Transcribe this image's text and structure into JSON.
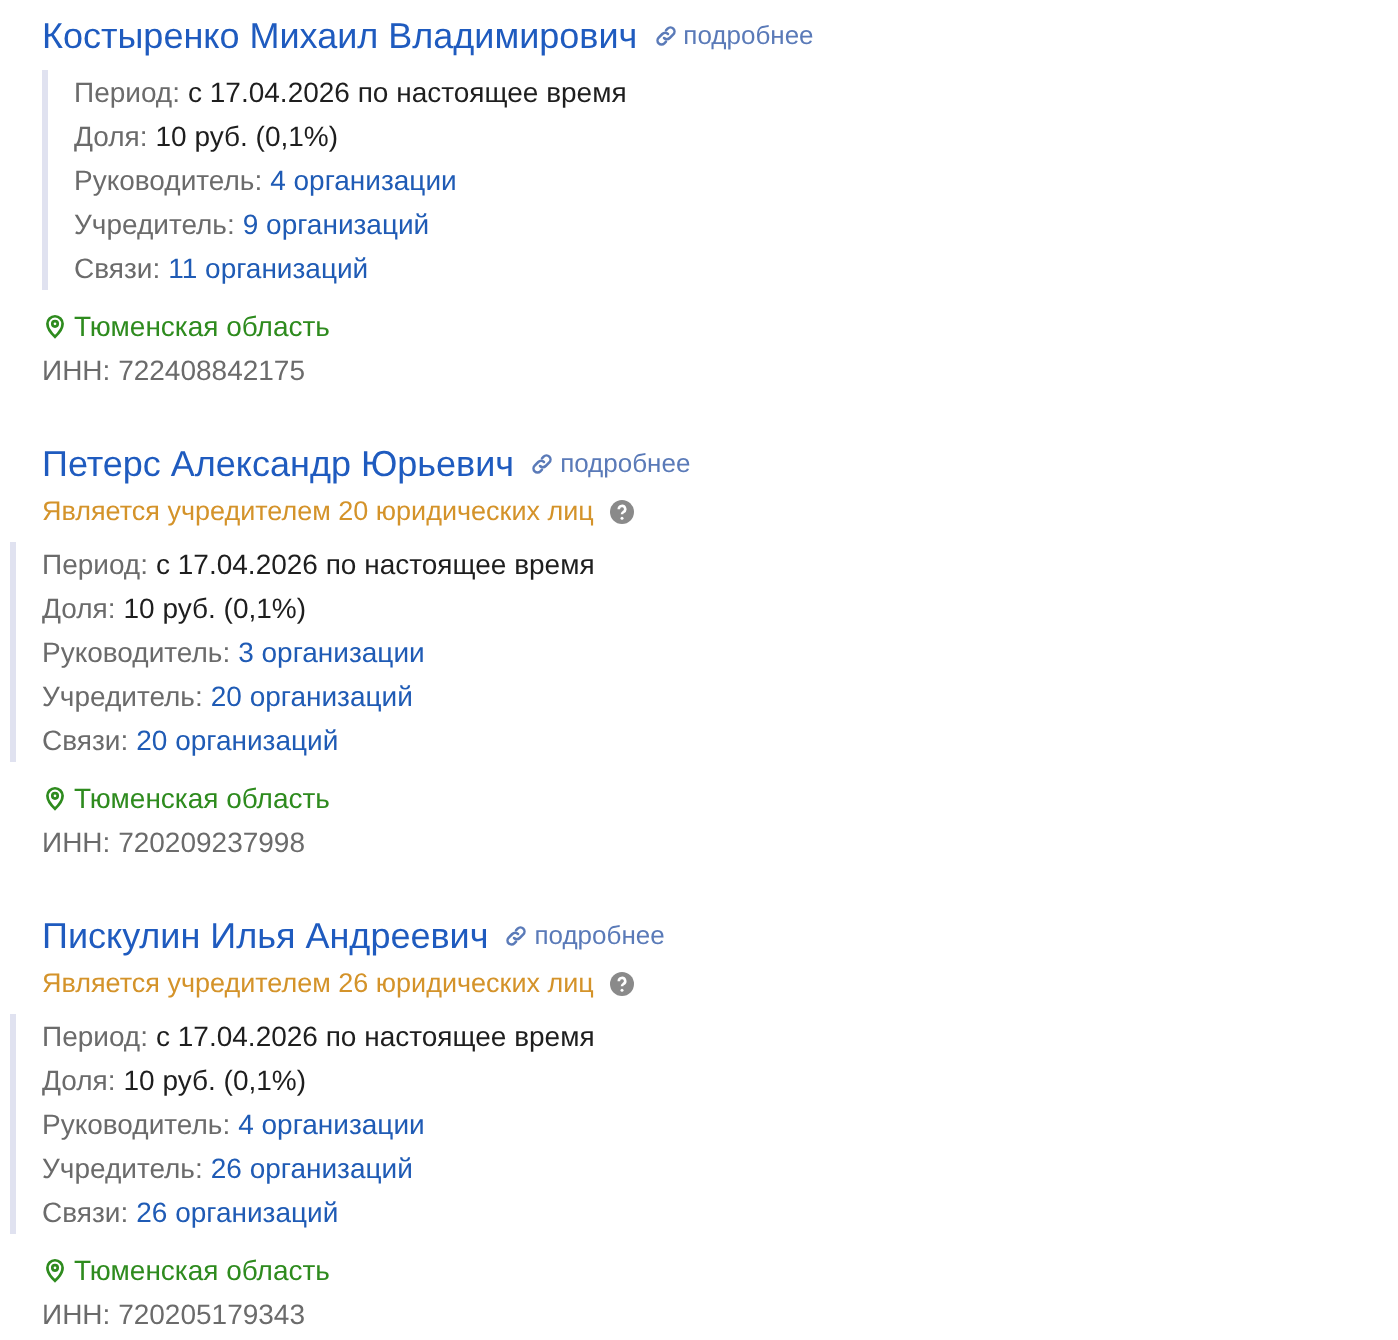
{
  "persons": [
    {
      "name": "Костыренко Михаил Владимирович",
      "more_link": "подробнее",
      "details": [
        {
          "label": "Период:",
          "value": "с 17.04.2026 по настоящее время",
          "kind": "text"
        },
        {
          "label": "Доля:",
          "value": "10 руб. (0,1%)",
          "kind": "text"
        },
        {
          "label": "Руководитель:",
          "value": "4 организации",
          "kind": "link"
        },
        {
          "label": "Учредитель:",
          "value": "9 организаций",
          "kind": "link"
        },
        {
          "label": "Связи:",
          "value": "11 организаций",
          "kind": "link"
        }
      ],
      "region": "Тюменская область",
      "inn": "ИНН: 722408842175"
    },
    {
      "name": "Петерс Александр Юрьевич",
      "more_link": "подробнее",
      "warning": "Является учредителем 20 юридических лиц",
      "details": [
        {
          "label": "Период:",
          "value": "с 17.04.2026 по настоящее время",
          "kind": "text"
        },
        {
          "label": "Доля:",
          "value": "10 руб. (0,1%)",
          "kind": "text"
        },
        {
          "label": "Руководитель:",
          "value": "3 организации",
          "kind": "link"
        },
        {
          "label": "Учредитель:",
          "value": "20 организаций",
          "kind": "link"
        },
        {
          "label": "Связи:",
          "value": "20 организаций",
          "kind": "link"
        }
      ],
      "region": "Тюменская область",
      "inn": "ИНН: 720209237998"
    },
    {
      "name": "Пискулин Илья Андреевич",
      "more_link": "подробнее",
      "warning": "Является учредителем 26 юридических лиц",
      "details": [
        {
          "label": "Период:",
          "value": "с 17.04.2026 по настоящее время",
          "kind": "text"
        },
        {
          "label": "Доля:",
          "value": "10 руб. (0,1%)",
          "kind": "text"
        },
        {
          "label": "Руководитель:",
          "value": "4 организации",
          "kind": "link"
        },
        {
          "label": "Учредитель:",
          "value": "26 организаций",
          "kind": "link"
        },
        {
          "label": "Связи:",
          "value": "26 организаций",
          "kind": "link"
        }
      ],
      "region": "Тюменская область",
      "inn": "ИНН: 720205179343"
    }
  ]
}
